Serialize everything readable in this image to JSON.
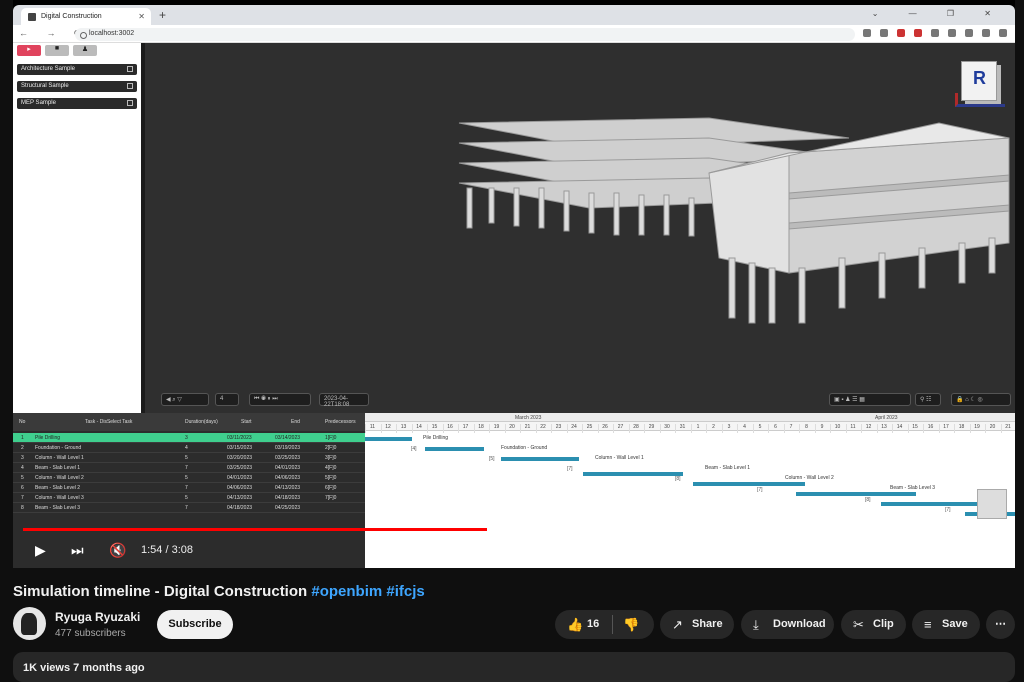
{
  "browser": {
    "tab_title": "Digital Construction",
    "url": "localhost:3002"
  },
  "sidebar": {
    "projects": [
      "Architecture Sample",
      "Structural Sample",
      "MEP Sample"
    ]
  },
  "viewer": {
    "timestamp": "2023-04-22T18:08",
    "frame_input": "4"
  },
  "gantt": {
    "headers": [
      "No",
      "Task - DisSelect Task",
      "Duration(days)",
      "Start",
      "End",
      "Predecessors"
    ],
    "rows": [
      {
        "no": "1",
        "task": "Pile Drilling",
        "duration": "3",
        "start": "03/11/2023",
        "end": "03/14/2023",
        "pred": "1[F]0"
      },
      {
        "no": "2",
        "task": "Foundation - Ground",
        "duration": "4",
        "start": "03/15/2023",
        "end": "03/19/2023",
        "pred": "2[F]0"
      },
      {
        "no": "3",
        "task": "Column - Wall Level 1",
        "duration": "5",
        "start": "03/20/2023",
        "end": "03/25/2023",
        "pred": "3[F]0"
      },
      {
        "no": "4",
        "task": "Beam - Slab Level 1",
        "duration": "7",
        "start": "03/25/2023",
        "end": "04/01/2023",
        "pred": "4[F]0"
      },
      {
        "no": "5",
        "task": "Column - Wall Level 2",
        "duration": "5",
        "start": "04/01/2023",
        "end": "04/06/2023",
        "pred": "5[F]0"
      },
      {
        "no": "6",
        "task": "Beam - Slab Level 2",
        "duration": "7",
        "start": "04/06/2023",
        "end": "04/13/2023",
        "pred": "6[F]0"
      },
      {
        "no": "7",
        "task": "Column - Wall Level 3",
        "duration": "5",
        "start": "04/13/2023",
        "end": "04/18/2023",
        "pred": "7[F]0"
      },
      {
        "no": "8",
        "task": "Beam - Slab Level 3",
        "duration": "7",
        "start": "04/18/2023",
        "end": "04/25/2023",
        "pred": ""
      }
    ],
    "months": [
      "March 2023",
      "April 2023"
    ],
    "days_march": [
      "11",
      "12",
      "13",
      "14",
      "15",
      "16",
      "17",
      "18",
      "19",
      "20",
      "21",
      "22",
      "23",
      "24",
      "25",
      "26",
      "27",
      "28",
      "29",
      "30",
      "31"
    ],
    "days_april": [
      "1",
      "2",
      "3",
      "4",
      "5",
      "6",
      "7",
      "8",
      "9",
      "10",
      "11",
      "12",
      "13",
      "14",
      "15",
      "16",
      "17",
      "18",
      "19",
      "20",
      "21"
    ],
    "bar_labels": [
      "Pile Drilling",
      "Foundation - Ground",
      "Column - Wall Level 1",
      "Beam - Slab Level 1",
      "Column - Wall Level 2",
      "Beam - Slab Level 3"
    ],
    "lag_labels": [
      "[4]",
      "[5]",
      "[7]",
      "[8]",
      "[7]",
      "[8]",
      "[7]"
    ]
  },
  "player": {
    "time": "1:54 / 3:08",
    "progress": 0.61
  },
  "video": {
    "title": "Simulation timeline - Digital Construction",
    "tags": "#openbim #ifcjs",
    "channel": "Ryuga Ryuzaki",
    "subscribers": "477 subscribers",
    "subscribe_label": "Subscribe",
    "likes": "16",
    "share_label": "Share",
    "download_label": "Download",
    "clip_label": "Clip",
    "save_label": "Save",
    "meta": "1K views  7 months ago"
  }
}
